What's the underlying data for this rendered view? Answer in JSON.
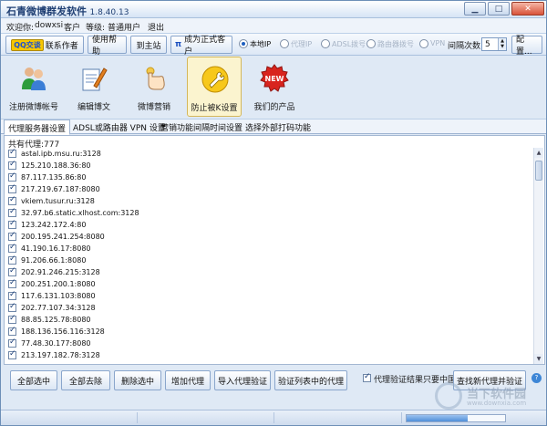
{
  "titlebar": {
    "app_name": "石青微博群发软件",
    "version": "1.8.40.13"
  },
  "user": {
    "welcome_label": "欢迎你:",
    "username": "dowxsi",
    "user_suffix": "客户",
    "level_label": "等级:",
    "level_value": "普通用户",
    "logout": "退出"
  },
  "toolbar": {
    "qq_badge": "QQ交谈",
    "contact_author": "联系作者",
    "help": "使用帮助",
    "main_site": "到主站",
    "pi_symbol": "π",
    "become_customer": "成为正式客户",
    "network_options": [
      {
        "label": "本地IP",
        "selected": true,
        "enabled": true
      },
      {
        "label": "代理IP",
        "selected": false,
        "enabled": false
      },
      {
        "label": "ADSL拨号",
        "selected": false,
        "enabled": false
      },
      {
        "label": "路由器拨号",
        "selected": false,
        "enabled": false
      },
      {
        "label": "VPN",
        "selected": false,
        "enabled": false
      }
    ],
    "retry_label": "间隔次数",
    "retry_value": "5",
    "config_button": "配置..."
  },
  "icon_nav": [
    {
      "label": "注册微博帐号",
      "icon": "users-icon",
      "active": false
    },
    {
      "label": "编辑博文",
      "icon": "edit-document-icon",
      "active": false
    },
    {
      "label": "微博营销",
      "icon": "hand-click-icon",
      "active": false
    },
    {
      "label": "防止被K设置",
      "icon": "wrench-icon",
      "active": true
    },
    {
      "label": "我们的产品",
      "icon": "new-badge-icon",
      "active": false
    }
  ],
  "tabs": [
    {
      "label": "代理服务器设置",
      "active": true
    },
    {
      "label": "ADSL或路由器 VPN 设置",
      "active": false
    },
    {
      "label": "营销功能间隔时间设置",
      "active": false
    },
    {
      "label": "选择外部打码功能",
      "active": false
    }
  ],
  "proxy_panel": {
    "count_label": "共有代理:777",
    "proxies": [
      "astal.ipb.msu.ru:3128",
      "125.210.188.36:80",
      "87.117.135.86:80",
      "217.219.67.187:8080",
      "vkiem.tusur.ru:3128",
      "32.97.b6.static.xlhost.com:3128",
      "123.242.172.4:80",
      "200.195.241.254:8080",
      "41.190.16.17:8080",
      "91.206.66.1:8080",
      "202.91.246.215:3128",
      "200.251.200.1:8080",
      "117.6.131.103:8080",
      "202.77.107.34:3128",
      "88.85.125.78:8080",
      "188.136.156.116:3128",
      "77.48.30.177:8080",
      "213.197.182.78:3128"
    ]
  },
  "bottom_buttons": {
    "select_all": "全部选中",
    "deselect_all": "全部去除",
    "delete_selected": "删除选中",
    "add_proxy": "增加代理",
    "import_verify": "导入代理验证",
    "verify_list": "验证列表中的代理",
    "china_only_label": "代理验证结果只要中国",
    "find_new_verify": "查找新代理并验证",
    "help_mark": "?"
  },
  "status": {
    "progress": 0.62
  },
  "watermark": {
    "text_cn": "当下软件园",
    "text_en": "www.downxia.com"
  },
  "colors": {
    "accent": "#1e5fbf",
    "window_bg": "#dfe9f5",
    "active_tab_bg": "#fbf4cf"
  }
}
